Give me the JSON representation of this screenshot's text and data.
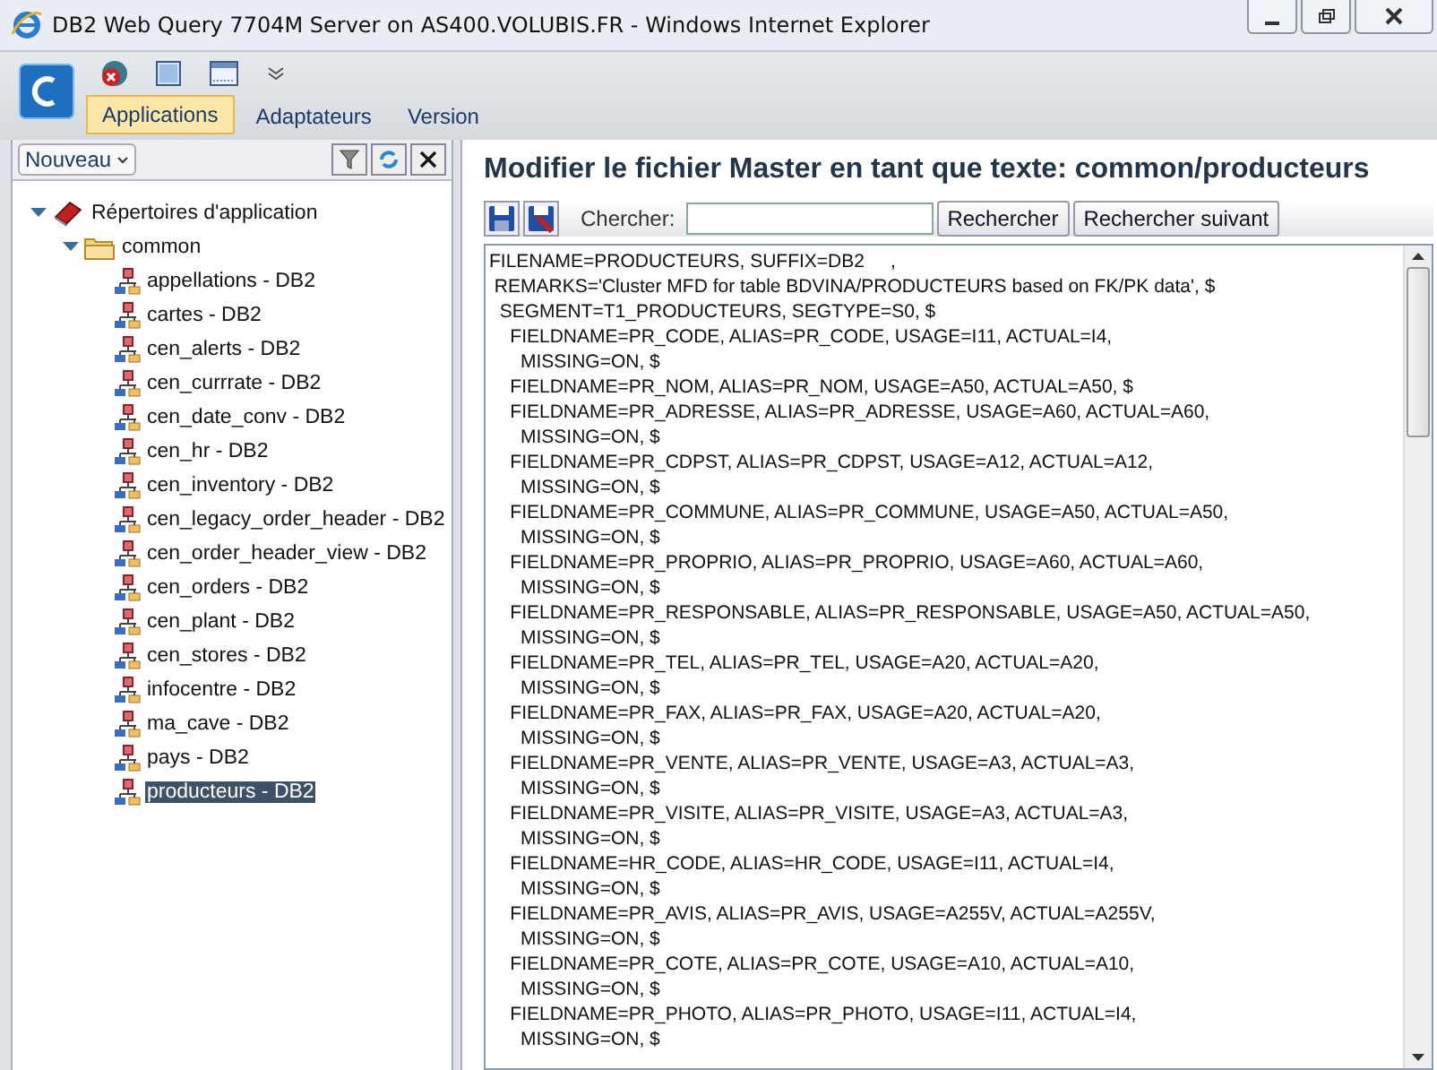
{
  "window": {
    "title": "DB2 Web Query 7704M Server on AS400.VOLUBIS.FR - Windows Internet Explorer"
  },
  "tabs": [
    {
      "label": "Applications",
      "selected": true
    },
    {
      "label": "Adaptateurs",
      "selected": false
    },
    {
      "label": "Version",
      "selected": false
    }
  ],
  "sidebar": {
    "new_menu": "Nouveau",
    "tree": [
      {
        "label": "Répertoires d'application",
        "kind": "root",
        "expanded": true,
        "selected": false,
        "children": [
          {
            "label": "common",
            "kind": "folder",
            "expanded": true,
            "selected": false,
            "children": [
              {
                "label": "appellations - DB2",
                "kind": "file",
                "selected": false
              },
              {
                "label": "cartes - DB2",
                "kind": "file",
                "selected": false
              },
              {
                "label": "cen_alerts - DB2",
                "kind": "file",
                "selected": false
              },
              {
                "label": "cen_currrate - DB2",
                "kind": "file",
                "selected": false
              },
              {
                "label": "cen_date_conv - DB2",
                "kind": "file",
                "selected": false
              },
              {
                "label": "cen_hr - DB2",
                "kind": "file",
                "selected": false
              },
              {
                "label": "cen_inventory - DB2",
                "kind": "file",
                "selected": false
              },
              {
                "label": "cen_legacy_order_header - DB2",
                "kind": "file",
                "selected": false
              },
              {
                "label": "cen_order_header_view - DB2",
                "kind": "file",
                "selected": false
              },
              {
                "label": "cen_orders - DB2",
                "kind": "file",
                "selected": false
              },
              {
                "label": "cen_plant - DB2",
                "kind": "file",
                "selected": false
              },
              {
                "label": "cen_stores - DB2",
                "kind": "file",
                "selected": false
              },
              {
                "label": "infocentre - DB2",
                "kind": "file",
                "selected": false
              },
              {
                "label": "ma_cave - DB2",
                "kind": "file",
                "selected": false
              },
              {
                "label": "pays - DB2",
                "kind": "file",
                "selected": false
              },
              {
                "label": "producteurs - DB2",
                "kind": "file",
                "selected": true
              }
            ]
          }
        ]
      }
    ]
  },
  "editor": {
    "title": "Modifier le fichier Master en tant que texte: common/producteurs",
    "search_label": "Chercher:",
    "search_button": "Rechercher",
    "next_button": "Rechercher suivant",
    "lines": [
      "FILENAME=PRODUCTEURS, SUFFIX=DB2     ,",
      " REMARKS='Cluster MFD for table BDVINA/PRODUCTEURS based on FK/PK data', $",
      "  SEGMENT=T1_PRODUCTEURS, SEGTYPE=S0, $",
      "    FIELDNAME=PR_CODE, ALIAS=PR_CODE, USAGE=I11, ACTUAL=I4,",
      "      MISSING=ON, $",
      "    FIELDNAME=PR_NOM, ALIAS=PR_NOM, USAGE=A50, ACTUAL=A50, $",
      "    FIELDNAME=PR_ADRESSE, ALIAS=PR_ADRESSE, USAGE=A60, ACTUAL=A60,",
      "      MISSING=ON, $",
      "    FIELDNAME=PR_CDPST, ALIAS=PR_CDPST, USAGE=A12, ACTUAL=A12,",
      "      MISSING=ON, $",
      "    FIELDNAME=PR_COMMUNE, ALIAS=PR_COMMUNE, USAGE=A50, ACTUAL=A50,",
      "      MISSING=ON, $",
      "    FIELDNAME=PR_PROPRIO, ALIAS=PR_PROPRIO, USAGE=A60, ACTUAL=A60,",
      "      MISSING=ON, $",
      "    FIELDNAME=PR_RESPONSABLE, ALIAS=PR_RESPONSABLE, USAGE=A50, ACTUAL=A50,",
      "      MISSING=ON, $",
      "    FIELDNAME=PR_TEL, ALIAS=PR_TEL, USAGE=A20, ACTUAL=A20,",
      "      MISSING=ON, $",
      "    FIELDNAME=PR_FAX, ALIAS=PR_FAX, USAGE=A20, ACTUAL=A20,",
      "      MISSING=ON, $",
      "    FIELDNAME=PR_VENTE, ALIAS=PR_VENTE, USAGE=A3, ACTUAL=A3,",
      "      MISSING=ON, $",
      "    FIELDNAME=PR_VISITE, ALIAS=PR_VISITE, USAGE=A3, ACTUAL=A3,",
      "      MISSING=ON, $",
      "    FIELDNAME=HR_CODE, ALIAS=HR_CODE, USAGE=I11, ACTUAL=I4,",
      "      MISSING=ON, $",
      "    FIELDNAME=PR_AVIS, ALIAS=PR_AVIS, USAGE=A255V, ACTUAL=A255V,",
      "      MISSING=ON, $",
      "    FIELDNAME=PR_COTE, ALIAS=PR_COTE, USAGE=A10, ACTUAL=A10,",
      "      MISSING=ON, $",
      "    FIELDNAME=PR_PHOTO, ALIAS=PR_PHOTO, USAGE=I11, ACTUAL=I4,",
      "      MISSING=ON, $"
    ]
  }
}
